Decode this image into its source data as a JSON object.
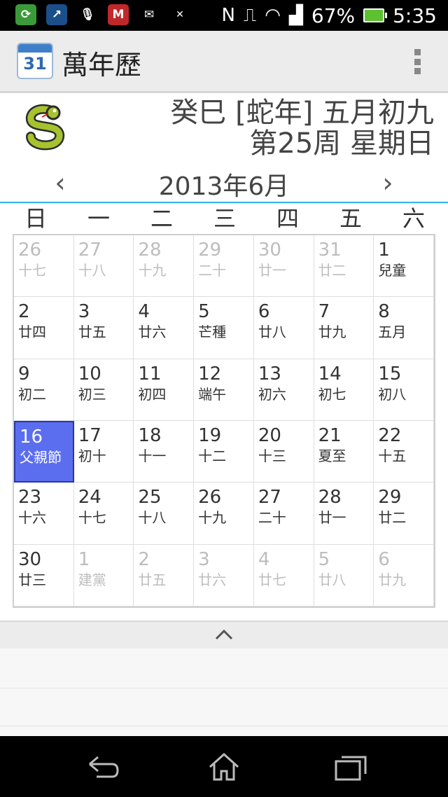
{
  "status_bar": {
    "battery_percent": "67%",
    "time": "5:35"
  },
  "app_bar": {
    "icon_number": "31",
    "title": "萬年歷"
  },
  "header": {
    "lunar_line1": "癸巳 [蛇年] 五月初九",
    "lunar_line2": "第25周 星期日",
    "month_title": "2013年6月",
    "prev_label": "‹",
    "next_label": "›"
  },
  "weekdays": [
    "日",
    "一",
    "二",
    "三",
    "四",
    "五",
    "六"
  ],
  "calendar": {
    "rows": [
      [
        {
          "day": "26",
          "lunar": "十七",
          "dim": true
        },
        {
          "day": "27",
          "lunar": "十八",
          "dim": true
        },
        {
          "day": "28",
          "lunar": "十九",
          "dim": true
        },
        {
          "day": "29",
          "lunar": "二十",
          "dim": true
        },
        {
          "day": "30",
          "lunar": "廿一",
          "dim": true
        },
        {
          "day": "31",
          "lunar": "廿二",
          "dim": true
        },
        {
          "day": "1",
          "lunar": "兒童",
          "dim": false
        }
      ],
      [
        {
          "day": "2",
          "lunar": "廿四",
          "dim": false
        },
        {
          "day": "3",
          "lunar": "廿五",
          "dim": false
        },
        {
          "day": "4",
          "lunar": "廿六",
          "dim": false
        },
        {
          "day": "5",
          "lunar": "芒種",
          "dim": false
        },
        {
          "day": "6",
          "lunar": "廿八",
          "dim": false
        },
        {
          "day": "7",
          "lunar": "廿九",
          "dim": false
        },
        {
          "day": "8",
          "lunar": "五月",
          "dim": false
        }
      ],
      [
        {
          "day": "9",
          "lunar": "初二",
          "dim": false
        },
        {
          "day": "10",
          "lunar": "初三",
          "dim": false
        },
        {
          "day": "11",
          "lunar": "初四",
          "dim": false
        },
        {
          "day": "12",
          "lunar": "端午",
          "dim": false
        },
        {
          "day": "13",
          "lunar": "初六",
          "dim": false
        },
        {
          "day": "14",
          "lunar": "初七",
          "dim": false
        },
        {
          "day": "15",
          "lunar": "初八",
          "dim": false
        }
      ],
      [
        {
          "day": "16",
          "lunar": "父親節",
          "dim": false,
          "today": true
        },
        {
          "day": "17",
          "lunar": "初十",
          "dim": false
        },
        {
          "day": "18",
          "lunar": "十一",
          "dim": false
        },
        {
          "day": "19",
          "lunar": "十二",
          "dim": false
        },
        {
          "day": "20",
          "lunar": "十三",
          "dim": false
        },
        {
          "day": "21",
          "lunar": "夏至",
          "dim": false
        },
        {
          "day": "22",
          "lunar": "十五",
          "dim": false
        }
      ],
      [
        {
          "day": "23",
          "lunar": "十六",
          "dim": false
        },
        {
          "day": "24",
          "lunar": "十七",
          "dim": false
        },
        {
          "day": "25",
          "lunar": "十八",
          "dim": false
        },
        {
          "day": "26",
          "lunar": "十九",
          "dim": false
        },
        {
          "day": "27",
          "lunar": "二十",
          "dim": false
        },
        {
          "day": "28",
          "lunar": "廿一",
          "dim": false
        },
        {
          "day": "29",
          "lunar": "廿二",
          "dim": false
        }
      ],
      [
        {
          "day": "30",
          "lunar": "廿三",
          "dim": false
        },
        {
          "day": "1",
          "lunar": "建黨",
          "dim": true
        },
        {
          "day": "2",
          "lunar": "廿五",
          "dim": true
        },
        {
          "day": "3",
          "lunar": "廿六",
          "dim": true
        },
        {
          "day": "4",
          "lunar": "廿七",
          "dim": true
        },
        {
          "day": "5",
          "lunar": "廿八",
          "dim": true
        },
        {
          "day": "6",
          "lunar": "廿九",
          "dim": true
        }
      ]
    ]
  },
  "drawer": {
    "handle_icon": "chevron-up-icon"
  },
  "nav_bar": {
    "icons": [
      "back-icon",
      "home-icon",
      "recents-icon"
    ]
  },
  "colors": {
    "accent": "#33b5e5",
    "today": "#5b6ef0"
  }
}
